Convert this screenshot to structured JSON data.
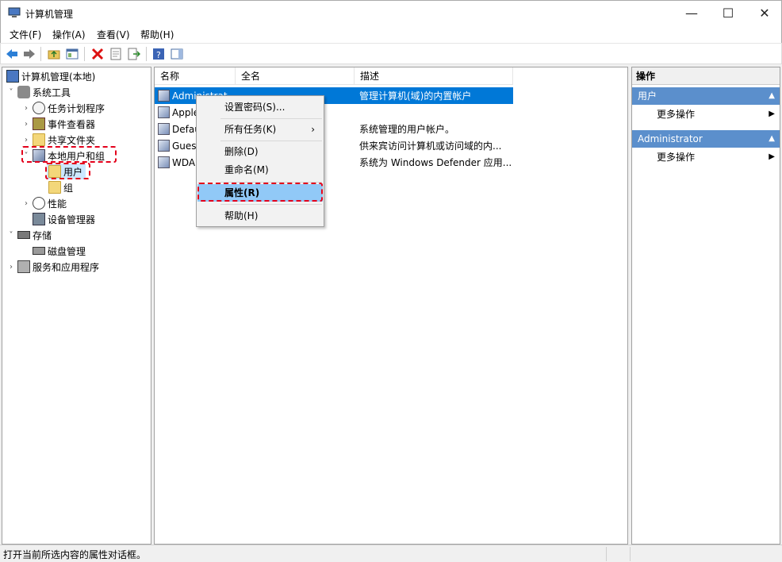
{
  "window": {
    "title": "计算机管理"
  },
  "menu": [
    "文件(F)",
    "操作(A)",
    "查看(V)",
    "帮助(H)"
  ],
  "tree": {
    "root": "计算机管理(本地)",
    "system_tools": "系统工具",
    "task_scheduler": "任务计划程序",
    "event_viewer": "事件查看器",
    "shared_folders": "共享文件夹",
    "local_users": "本地用户和组",
    "users": "用户",
    "groups": "组",
    "performance": "性能",
    "device_manager": "设备管理器",
    "storage": "存储",
    "disk_management": "磁盘管理",
    "services": "服务和应用程序"
  },
  "list": {
    "columns": [
      "名称",
      "全名",
      "描述"
    ],
    "rows": [
      {
        "name": "Administrat",
        "fullname": "",
        "desc": "管理计算机(域)的内置帐户"
      },
      {
        "name": "Apple",
        "fullname": "",
        "desc": ""
      },
      {
        "name": "Defau",
        "fullname": "",
        "desc": "系统管理的用户帐户。"
      },
      {
        "name": "Gues",
        "fullname": "",
        "desc": "供来宾访问计算机或访问域的内..."
      },
      {
        "name": "WDA",
        "fullname": "",
        "desc": "系统为 Windows Defender 应用..."
      }
    ]
  },
  "context_menu": {
    "set_password": "设置密码(S)...",
    "all_tasks": "所有任务(K)",
    "delete": "删除(D)",
    "rename": "重命名(M)",
    "properties": "属性(R)",
    "help": "帮助(H)"
  },
  "actions": {
    "title": "操作",
    "section1": "用户",
    "more1": "更多操作",
    "section2": "Administrator",
    "more2": "更多操作"
  },
  "status": {
    "text": "打开当前所选内容的属性对话框。"
  },
  "colors": {
    "selection": "#0078d7",
    "highlight": "#91c9f7",
    "annotation": "#e3001b",
    "action_header": "#5b8fcc"
  }
}
